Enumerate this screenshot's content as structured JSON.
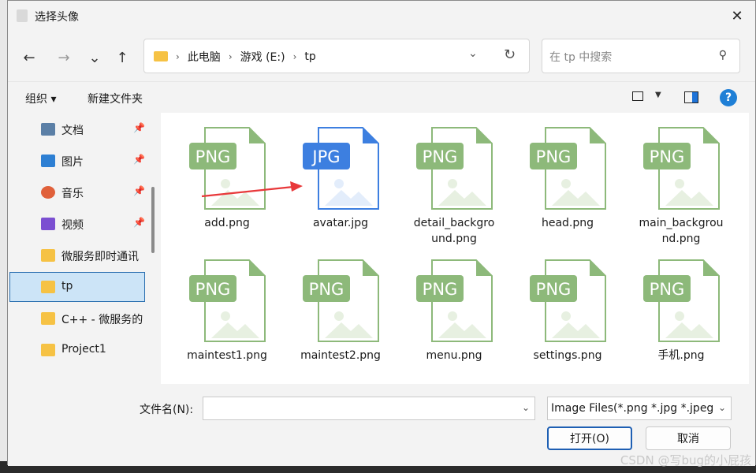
{
  "window": {
    "title": "选择头像",
    "close_label": "✕"
  },
  "nav": {
    "back": "←",
    "forward": "→",
    "recent": "⌄",
    "up": "↑"
  },
  "address": {
    "crumbs": [
      "此电脑",
      "游戏 (E:)",
      "tp"
    ],
    "sep": "›",
    "dropdown": "⌄",
    "refresh": "↻"
  },
  "search": {
    "placeholder": "在 tp 中搜索",
    "icon": "⚲"
  },
  "toolbar": {
    "organize": "组织 ▾",
    "new_folder": "新建文件夹",
    "view_dd": "▼",
    "help": "?"
  },
  "sidebar": {
    "items": [
      {
        "label": "文档",
        "icon": "document-icon",
        "color": "#5b7fa6",
        "pinned": true
      },
      {
        "label": "图片",
        "icon": "pictures-icon",
        "color": "#2d7fd3",
        "pinned": true
      },
      {
        "label": "音乐",
        "icon": "music-icon",
        "color": "#e0603a",
        "pinned": true
      },
      {
        "label": "视频",
        "icon": "video-icon",
        "color": "#7b4fd1",
        "pinned": true
      },
      {
        "label": "微服务即时通讯",
        "icon": "folder-icon",
        "color": "#f6c244",
        "pinned": false
      },
      {
        "label": "tp",
        "icon": "folder-icon",
        "color": "#f6c244",
        "pinned": false,
        "selected": true
      },
      {
        "label": "C++ - 微服务的",
        "icon": "folder-icon",
        "color": "#f6c244",
        "pinned": false
      },
      {
        "label": "Project1",
        "icon": "folder-icon",
        "color": "#f6c244",
        "pinned": false
      }
    ],
    "pin_glyph": "📌"
  },
  "files": [
    {
      "name": "add.png",
      "badge": "PNG"
    },
    {
      "name": "avatar.jpg",
      "badge": "JPG"
    },
    {
      "name": "detail_backgro\nund.png",
      "badge": "PNG"
    },
    {
      "name": "head.png",
      "badge": "PNG"
    },
    {
      "name": "main_backgrou\nnd.png",
      "badge": "PNG"
    },
    {
      "name": "maintest1.png",
      "badge": "PNG"
    },
    {
      "name": "maintest2.png",
      "badge": "PNG"
    },
    {
      "name": "menu.png",
      "badge": "PNG"
    },
    {
      "name": "settings.png",
      "badge": "PNG"
    },
    {
      "name": "手机.png",
      "badge": "PNG"
    }
  ],
  "colors": {
    "png": "#8db97a",
    "png_light": "#e7f0e1",
    "jpg": "#3d7fe0",
    "jpg_light": "#e3edfb",
    "arrow": "#e8383a"
  },
  "bottom": {
    "filename_label": "文件名(N):",
    "filename_value": "",
    "filetype": "Image Files(*.png *.jpg *.jpeg",
    "open": "打开(O)",
    "cancel": "取消"
  },
  "watermark": "CSDN @写bug的小屁孩"
}
